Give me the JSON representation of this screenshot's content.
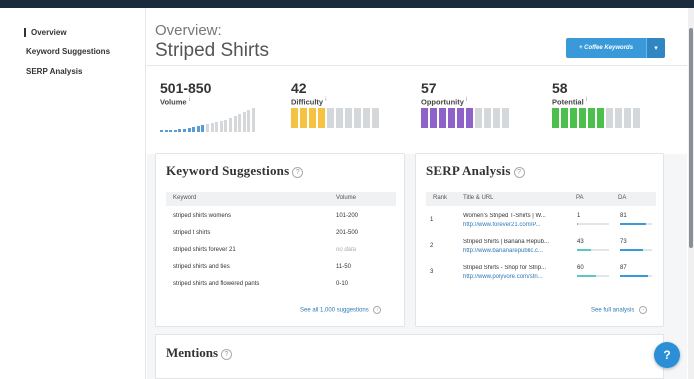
{
  "sidebar": {
    "items": [
      {
        "label": "Overview",
        "active": true
      },
      {
        "label": "Keyword Suggestions",
        "active": false
      },
      {
        "label": "SERP Analysis",
        "active": false
      }
    ]
  },
  "header": {
    "overview_label": "Overview:",
    "title": "Striped Shirts",
    "button_label": "+ Coffee Keywords",
    "button_caret": "▾",
    "accent_color": "#3a9ad9"
  },
  "metrics": [
    {
      "value": "501-850",
      "label": "Volume",
      "color": "#5b9bd5"
    },
    {
      "value": "42",
      "label": "Difficulty",
      "color": "#f5c242",
      "filled_segments": 4,
      "total_segments": 10
    },
    {
      "value": "57",
      "label": "Opportunity",
      "color": "#8e62c9",
      "filled_segments": 6,
      "total_segments": 10
    },
    {
      "value": "58",
      "label": "Potential",
      "color": "#4cbf4c",
      "filled_segments": 6,
      "total_segments": 10
    }
  ],
  "keyword_suggestions": {
    "title": "Keyword Suggestions",
    "headers": {
      "keyword": "Keyword",
      "volume": "Volume"
    },
    "rows": [
      {
        "keyword": "striped shirts womens",
        "volume": "101-200"
      },
      {
        "keyword": "striped t shirts",
        "volume": "201-500"
      },
      {
        "keyword": "striped shirts forever 21",
        "volume": "no data"
      },
      {
        "keyword": "striped shirts and ties",
        "volume": "11-50"
      },
      {
        "keyword": "striped shirts and flowered pants",
        "volume": "0-10"
      }
    ],
    "see_all": "See all 1,000 suggestions"
  },
  "serp_analysis": {
    "title": "SERP Analysis",
    "headers": {
      "rank": "Rank",
      "title_url": "Title & URL",
      "pa": "PA",
      "da": "DA"
    },
    "rows": [
      {
        "rank": "1",
        "title": "Women's Striped T-Shirts | W...",
        "url": "http://www.forever21.com/P...",
        "pa": "1",
        "da": "81"
      },
      {
        "rank": "2",
        "title": "Striped Shirts | Banana Repub...",
        "url": "http://www.bananarepublic.c...",
        "pa": "43",
        "da": "73"
      },
      {
        "rank": "3",
        "title": "Striped Shirts - Shop for Strip...",
        "url": "http://www.polyvore.com/stri...",
        "pa": "60",
        "da": "87"
      }
    ],
    "see_full": "See full analysis"
  },
  "mentions": {
    "title": "Mentions"
  },
  "chat": {
    "label": "?"
  }
}
